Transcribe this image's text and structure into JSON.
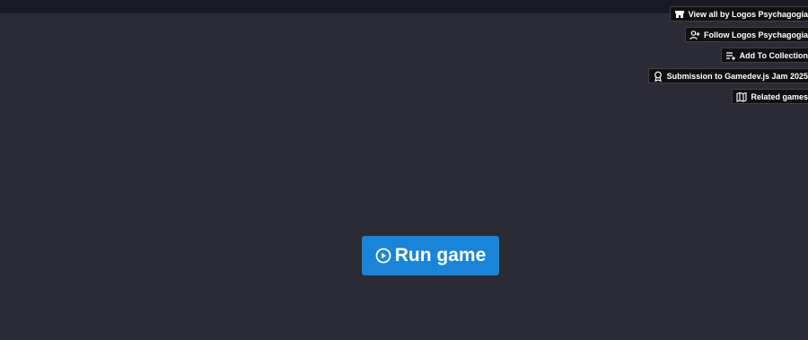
{
  "colors": {
    "background": "#2b2b35",
    "topbar": "#191923",
    "button_bg": "#111114",
    "run_button": "#1a84d8"
  },
  "user_tools": [
    {
      "label": "View all by Logos Psychagogia",
      "icon": "itch-store-icon"
    },
    {
      "label": "Follow Logos Psychagogia",
      "icon": "user-plus-icon"
    },
    {
      "label": "Add To Collection",
      "icon": "playlist-add-icon"
    },
    {
      "label": "Submission to Gamedev.js Jam 2025",
      "icon": "award-icon"
    },
    {
      "label": "Related games",
      "icon": "map-icon"
    }
  ],
  "run_game": {
    "label": "Run game",
    "icon": "play-circle-icon"
  }
}
